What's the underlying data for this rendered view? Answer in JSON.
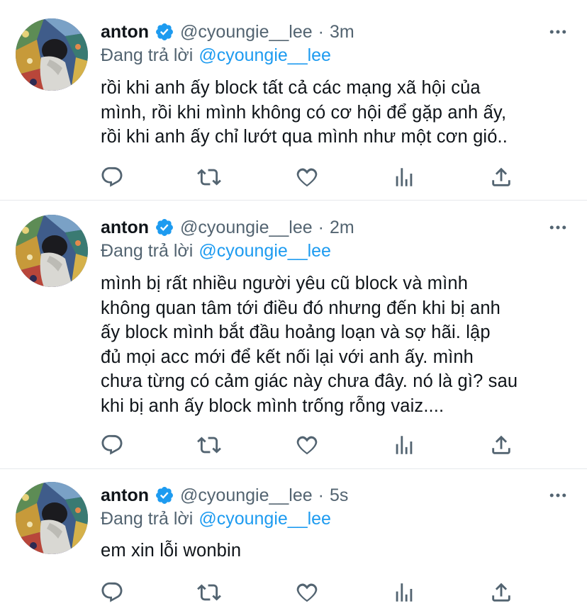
{
  "tweets": [
    {
      "name": "anton",
      "handle": "@cyoungie__lee",
      "dot": "·",
      "time": "3m",
      "reply_prefix": "Đang trả lời",
      "reply_to": "@cyoungie__lee",
      "lines": [
        "rồi khi anh ấy block tất cả các mạng xã hội của",
        "mình, rồi khi mình không có cơ hội để gặp anh ấy,",
        "rồi khi anh ấy chỉ lướt qua mình như một cơn gió.."
      ]
    },
    {
      "name": "anton",
      "handle": "@cyoungie__lee",
      "dot": "·",
      "time": "2m",
      "reply_prefix": "Đang trả lời",
      "reply_to": "@cyoungie__lee",
      "lines": [
        "mình bị rất nhiều người yêu cũ block và mình",
        "không quan tâm tới điều đó nhưng đến khi bị anh",
        "ấy block mình bắt đầu hoảng loạn và sợ hãi. lập",
        "đủ mọi acc mới để kết nối lại với anh ấy. mình",
        "chưa từng có cảm giác này chưa đây. nó là gì? sau",
        "khi bị anh ấy block mình trống rỗng vaiz...."
      ]
    },
    {
      "name": "anton",
      "handle": "@cyoungie__lee",
      "dot": "·",
      "time": "5s",
      "reply_prefix": "Đang trả lời",
      "reply_to": "@cyoungie__lee",
      "lines": [
        "em xin lỗi wonbin"
      ]
    }
  ],
  "icons": {
    "verified": "verified-badge-icon",
    "more": "more-dots-icon",
    "reply": "reply-bubble-icon",
    "retweet": "retweet-icon",
    "like": "heart-icon",
    "views": "analytics-bars-icon",
    "share": "share-upload-icon"
  },
  "colors": {
    "accent": "#1d9bf0",
    "text": "#0f1419",
    "secondary": "#536471",
    "divider": "#e6e9ec"
  }
}
